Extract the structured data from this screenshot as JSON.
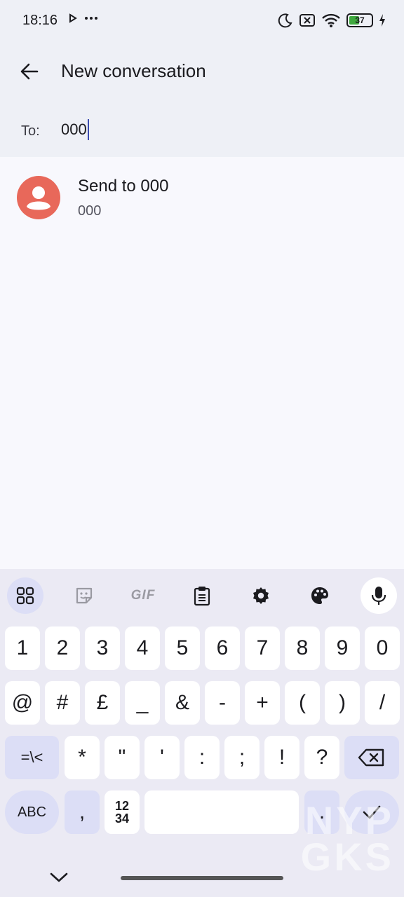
{
  "status_bar": {
    "time": "18:16",
    "battery": "37",
    "icons": [
      "play-icon",
      "more-dots-icon",
      "moon-icon",
      "sim-off-icon",
      "wifi-icon",
      "battery-icon",
      "charging-icon"
    ]
  },
  "app_bar": {
    "title": "New conversation"
  },
  "recipient": {
    "label": "To:",
    "value": "000"
  },
  "suggestion": {
    "title": "Send to 000",
    "subtitle": "000"
  },
  "keyboard": {
    "toolbar": {
      "gif_label": "GIF"
    },
    "row1": [
      "1",
      "2",
      "3",
      "4",
      "5",
      "6",
      "7",
      "8",
      "9",
      "0"
    ],
    "row2": [
      "@",
      "#",
      "£",
      "_",
      "&",
      "-",
      "+",
      "(",
      ")",
      "/"
    ],
    "row3": [
      "=\\<",
      "*",
      "\"",
      "'",
      ":",
      ";",
      "!",
      "?"
    ],
    "row4": {
      "abc": "ABC",
      "comma": ",",
      "num_top": "12",
      "num_bottom": "34",
      "period": "."
    }
  },
  "watermark": {
    "line1": "NYP",
    "line2": "GKS"
  },
  "colors": {
    "accent": "#3a4bb0",
    "avatar": "#e8685a",
    "fn_key": "#dcdef6"
  }
}
